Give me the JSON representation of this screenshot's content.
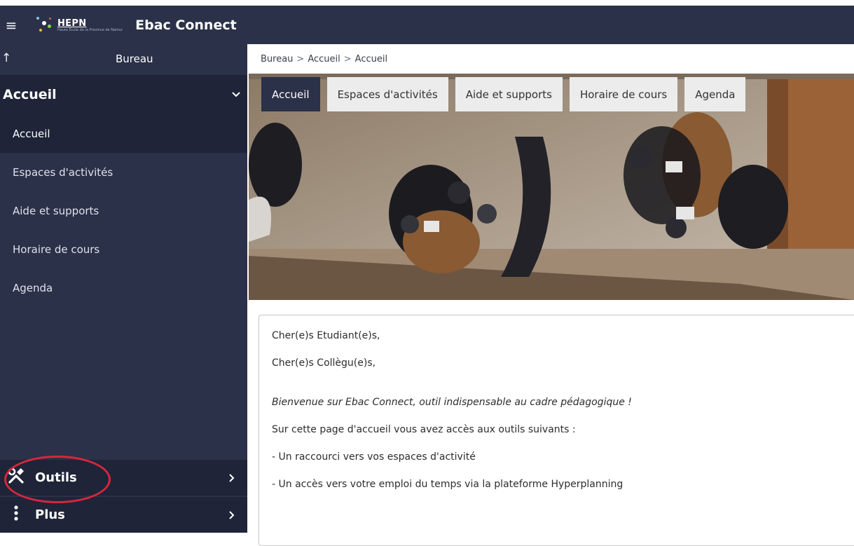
{
  "header": {
    "logo_title": "HEPN",
    "logo_subtitle": "Haute École de la Province de Namur",
    "app_title": "Ebac Connect"
  },
  "sidebar": {
    "head_title": "Bureau",
    "section_title": "Accueil",
    "items": [
      {
        "label": "Accueil",
        "active": true
      },
      {
        "label": "Espaces d'activités",
        "active": false
      },
      {
        "label": "Aide et supports",
        "active": false
      },
      {
        "label": "Horaire de cours",
        "active": false
      },
      {
        "label": "Agenda",
        "active": false
      }
    ],
    "bottom": [
      {
        "label": "Outils",
        "icon": "tools-icon"
      },
      {
        "label": "Plus",
        "icon": "more-vertical-icon"
      }
    ]
  },
  "breadcrumb": [
    "Bureau",
    "Accueil",
    "Accueil"
  ],
  "tabs": [
    {
      "label": "Accueil",
      "active": true
    },
    {
      "label": "Espaces d'activités",
      "active": false
    },
    {
      "label": "Aide et supports",
      "active": false
    },
    {
      "label": "Horaire de cours",
      "active": false
    },
    {
      "label": "Agenda",
      "active": false
    }
  ],
  "content": {
    "line1": "Cher(e)s Etudiant(e)s,",
    "line2": "Cher(e)s Collègu(e)s,",
    "welcome": "Bienvenue sur Ebac Connect, outil indispensable au cadre pédagogique !",
    "intro": "Sur cette page d'accueil vous avez accès aux outils suivants :",
    "bullet1": "- Un raccourci vers vos espaces d'activité",
    "bullet2": "- Un accès vers votre emploi du temps via la plateforme Hyperplanning"
  },
  "colors": {
    "nav_bg": "#2b3148",
    "nav_active": "#1f2438",
    "highlight_ring": "#d7263d"
  }
}
